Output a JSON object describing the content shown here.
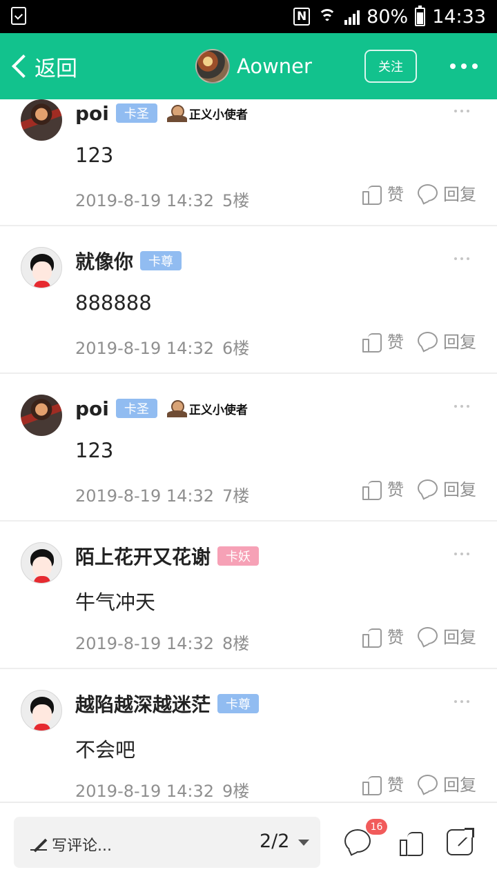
{
  "status_bar": {
    "battery": "80%",
    "time": "14:33"
  },
  "nav": {
    "back_label": "返回",
    "author_name": "Aowner",
    "follow_label": "关注"
  },
  "comments": [
    {
      "username": "poi",
      "rank": "卡圣",
      "medal": "正义小使者",
      "content": "123",
      "date": "2019-8-19 14:32",
      "floor": "5楼",
      "like_label": "赞",
      "reply_label": "回复"
    },
    {
      "username": "就像你",
      "rank": "卡尊",
      "content": "888888",
      "date": "2019-8-19 14:32",
      "floor": "6楼",
      "like_label": "赞",
      "reply_label": "回复"
    },
    {
      "username": "poi",
      "rank": "卡圣",
      "medal": "正义小使者",
      "content": "123",
      "date": "2019-8-19 14:32",
      "floor": "7楼",
      "like_label": "赞",
      "reply_label": "回复"
    },
    {
      "username": "陌上花开又花谢",
      "rank": "卡妖",
      "content": "牛气冲天",
      "date": "2019-8-19 14:32",
      "floor": "8楼",
      "like_label": "赞",
      "reply_label": "回复"
    },
    {
      "username": "越陷越深越迷茫",
      "rank": "卡尊",
      "content": "不会吧",
      "date": "2019-8-19 14:32",
      "floor": "9楼",
      "like_label": "赞",
      "reply_label": "回复"
    }
  ],
  "bottom_bar": {
    "comment_placeholder": "写评论...",
    "page": "2/2",
    "comment_count": "16"
  },
  "icons": {
    "status_left": "clipboard-check-icon",
    "status_nfc": "nfc-icon",
    "status_wifi": "wifi-icon",
    "status_signal": "signal-icon",
    "status_battery": "battery-icon",
    "back": "chevron-left-icon",
    "more": "more-horizontal-icon",
    "like": "thumbs-up-icon",
    "reply": "chat-bubble-icon",
    "write": "pencil-icon",
    "share": "share-icon"
  },
  "colors": {
    "accent": "#12c28d",
    "badge_blue": "#91bcf1",
    "badge_pink": "#f6a1b6",
    "notification": "#f15b5b"
  }
}
